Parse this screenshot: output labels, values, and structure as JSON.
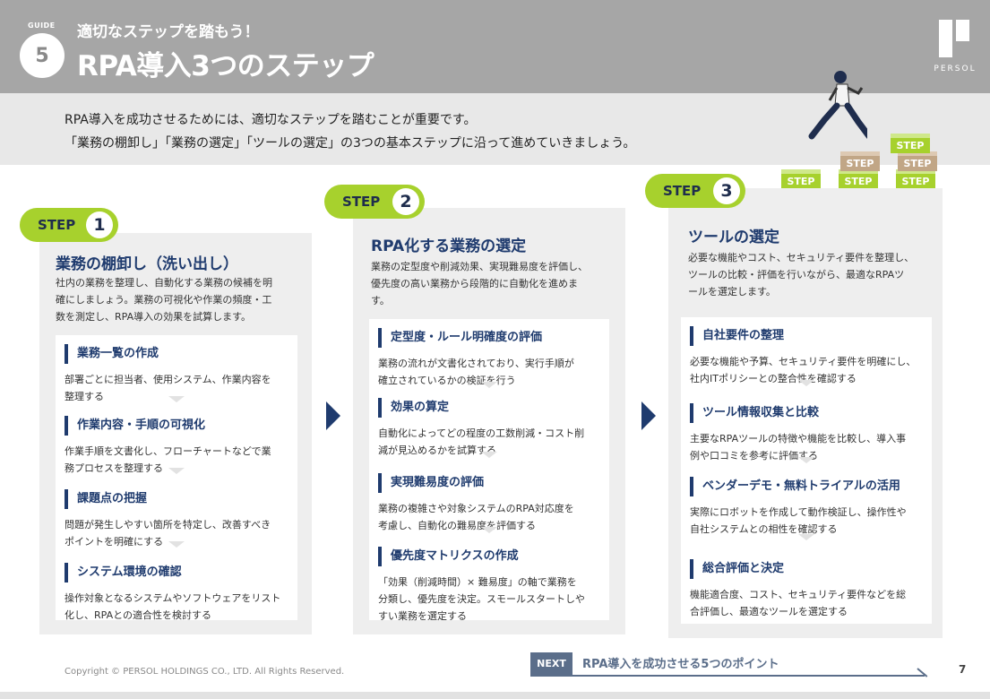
{
  "header": {
    "guide_label": "GUIDE",
    "guide_number": "5",
    "subtitle": "適切なステップを踏もう！",
    "title": "RPA導入3つのステップ",
    "logo_text": "PERSOL"
  },
  "intro": {
    "line1": "RPA導入を成功させるためには、適切なステップを踏むことが重要です。",
    "line2": "「業務の棚卸し」「業務の選定」「ツールの選定」の3つの基本ステップに沿って進めていきましょう。"
  },
  "illustration": {
    "box_label": "STEP"
  },
  "steps": [
    {
      "label": "STEP",
      "number": "1",
      "title": "業務の棚卸し（洗い出し）",
      "desc": [
        "社内の業務を整理し、自動化する業務の候補を明",
        "確にしましょう。業務の可視化や作業の頻度・工",
        "数を測定し、RPA導入の効果を試算します。"
      ],
      "items": [
        {
          "title": "業務一覧の作成",
          "desc": [
            "部署ごとに担当者、使用システム、作業内容を",
            "整理する"
          ]
        },
        {
          "title": "作業内容・手順の可視化",
          "desc": [
            "作業手順を文書化し、フローチャートなどで業",
            "務プロセスを整理する"
          ]
        },
        {
          "title": "課題点の把握",
          "desc": [
            "問題が発生しやすい箇所を特定し、改善すべき",
            "ポイントを明確にする"
          ]
        },
        {
          "title": "システム環境の確認",
          "desc": [
            "操作対象となるシステムやソフトウェアをリスト",
            "化し、RPAとの適合性を検討する"
          ]
        }
      ]
    },
    {
      "label": "STEP",
      "number": "2",
      "title": "RPA化する業務の選定",
      "desc": [
        "業務の定型度や削減効果、実現難易度を評価し、",
        "優先度の高い業務から段階的に自動化を進めま",
        "す。"
      ],
      "items": [
        {
          "title": "定型度・ルール明確度の評価",
          "desc": [
            "業務の流れが文書化されており、実行手順が",
            "確立されているかの検証を行う"
          ]
        },
        {
          "title": "効果の算定",
          "desc": [
            "自動化によってどの程度の工数削減・コスト削",
            "減が見込めるかを試算する"
          ]
        },
        {
          "title": "実現難易度の評価",
          "desc": [
            "業務の複雑さや対象システムのRPA対応度を",
            "考慮し、自動化の難易度を評価する"
          ]
        },
        {
          "title": "優先度マトリクスの作成",
          "desc": [
            "「効果（削減時間）× 難易度」の軸で業務を",
            "分類し、優先度を決定。スモールスタートしや",
            "すい業務を選定する"
          ]
        }
      ]
    },
    {
      "label": "STEP",
      "number": "3",
      "title": "ツールの選定",
      "desc": [
        "必要な機能やコスト、セキュリティ要件を整理し、",
        "ツールの比較・評価を行いながら、最適なRPAツ",
        "ールを選定します。"
      ],
      "items": [
        {
          "title": "自社要件の整理",
          "desc": [
            "必要な機能や予算、セキュリティ要件を明確にし、",
            "社内ITポリシーとの整合性を確認する"
          ]
        },
        {
          "title": "ツール情報収集と比較",
          "desc": [
            "主要なRPAツールの特徴や機能を比較し、導入事",
            "例や口コミを参考に評価する"
          ]
        },
        {
          "title": "ベンダーデモ・無料トライアルの活用",
          "desc": [
            "実際にロボットを作成して動作検証し、操作性や",
            "自社システムとの相性を確認する"
          ]
        },
        {
          "title": "総合評価と決定",
          "desc": [
            "機能適合度、コスト、セキュリティ要件などを総",
            "合評価し、最適なツールを選定する"
          ]
        }
      ]
    }
  ],
  "footer": {
    "copyright": "Copyright © PERSOL HOLDINGS CO., LTD. All Rights Reserved.",
    "next_label": "NEXT",
    "next_text": "RPA導入を成功させる5つのポイント",
    "page_number": "7"
  },
  "colors": {
    "header_bg": "#a6a6a6",
    "accent_green": "#a7d12d",
    "navy": "#1f3b6e",
    "step_brown": "#c1a686"
  }
}
